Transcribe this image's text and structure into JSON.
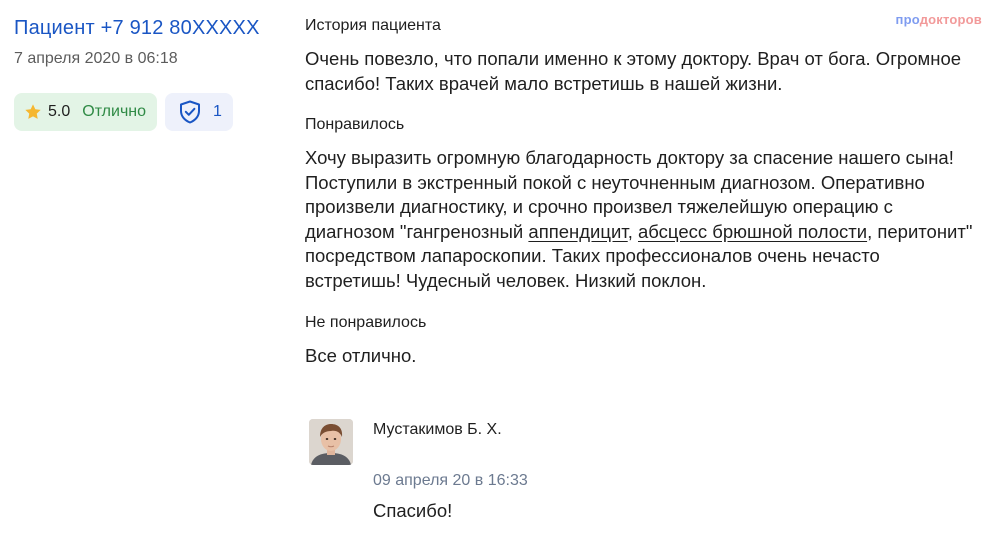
{
  "review": {
    "author": "Пациент +7 912 80XXXXX",
    "date": "7 апреля 2020 в 06:18",
    "rating": {
      "score": "5.0",
      "label": "Отлично",
      "icon": "star-icon",
      "color": "#f5b731",
      "bg": "#e3f4e6"
    },
    "verified": {
      "count": "1",
      "icon": "shield-check-icon"
    },
    "history": {
      "title": "История пациента",
      "text": "Очень повезло, что попали именно к этому доктору. Врач от бога. Огромное спасибо! Таких врачей мало встретишь в нашей жизни."
    },
    "liked": {
      "title": "Понравилось",
      "text_part1": "Хочу выразить огромную благодарность доктору за спасение нашего сына! Поступили в экстренный покой с неуточненным диагнозом. Оперативно произвели диагностику, и срочно произвел тяжелейшую операцию с диагнозом \"гангренозный ",
      "link1": "аппендицит",
      "sep": ", ",
      "link2": "абсцесс брюшной полости",
      "text_part2": ", перитонит\" посредством лапароскопии. Таких профессионалов очень нечасто встретишь! Чудесный человек. Низкий поклон."
    },
    "disliked": {
      "title": "Не понравилось",
      "text": "Все отлично."
    }
  },
  "brand": {
    "part1": "про",
    "part2": "докторов"
  },
  "reply": {
    "name": "Мустакимов Б. Х.",
    "date": "09 апреля 20 в 16:33",
    "text": "Спасибо!"
  },
  "colors": {
    "link_blue": "#1a56c4",
    "green_text": "#2f8a45",
    "reply_date": "#6c7a90"
  }
}
